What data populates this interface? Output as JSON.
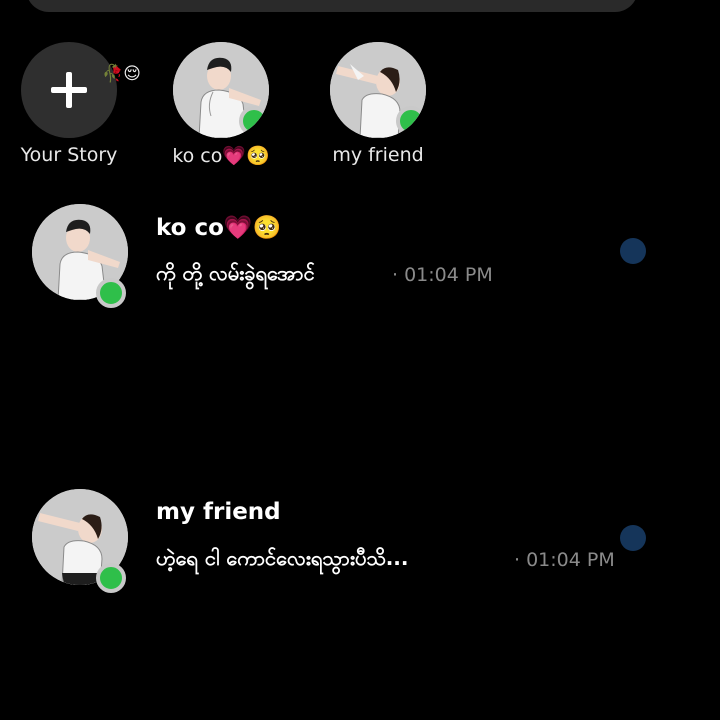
{
  "stories": {
    "your_story": {
      "label": "Your Story",
      "icon": "plus-icon",
      "emoji": "🥀😌"
    },
    "items": [
      {
        "label": "ko co💗🥺",
        "online": true
      },
      {
        "label": "my friend",
        "online": true
      }
    ]
  },
  "chats": [
    {
      "name": "ko co💗🥺",
      "preview": "ကို တို့ လမ်းခွဲရအောင်",
      "time": "· 01:04 PM",
      "online": true,
      "unread": true
    },
    {
      "name": "my friend",
      "preview": "ဟဲ့ရေ ငါ ကောင်လေးရသွားပီသိ...",
      "time": "· 01:04 PM",
      "online": true,
      "unread": true
    }
  ],
  "colors": {
    "background": "#000000",
    "online": "#2fbf4a",
    "unread": "#15355a",
    "time": "#8a8a8a"
  }
}
